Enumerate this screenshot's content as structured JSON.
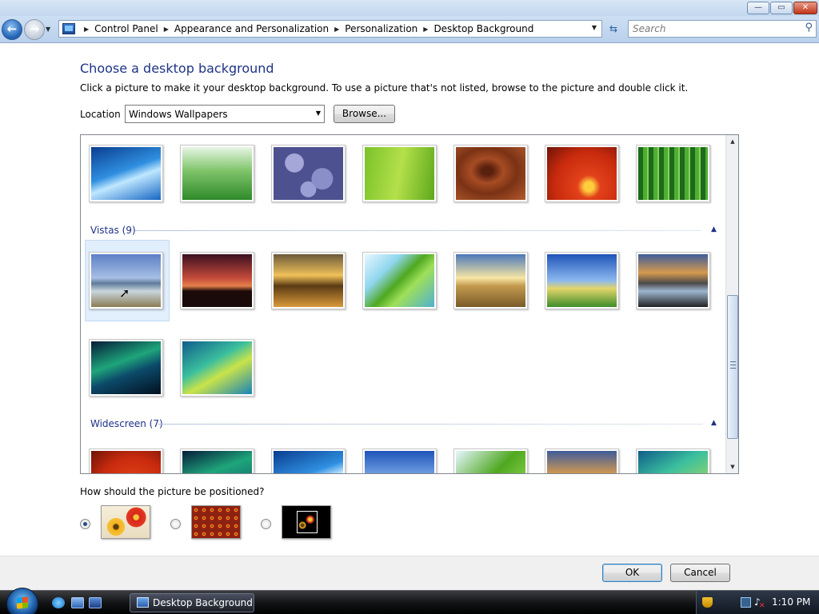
{
  "window": {
    "minimize_glyph": "—",
    "maximize_glyph": "▭",
    "close_glyph": "✕"
  },
  "nav": {
    "back_glyph": "←",
    "forward_glyph": "→",
    "breadcrumbs": [
      "Control Panel",
      "Appearance and Personalization",
      "Personalization",
      "Desktop Background"
    ],
    "search_placeholder": "Search"
  },
  "page": {
    "title": "Choose a desktop background",
    "description": "Click a picture to make it your desktop background. To use a picture that's not listed, browse to the picture and double click it.",
    "location_label": "Location",
    "location_value": "Windows Wallpapers",
    "browse_label": "Browse..."
  },
  "gallery": {
    "groups": [
      {
        "name": "Vistas (9)"
      },
      {
        "name": "Widescreen (7)"
      }
    ],
    "top_row": [
      {
        "subject": "fish"
      },
      {
        "subject": "grass"
      },
      {
        "subject": "stones"
      },
      {
        "subject": "leaf"
      },
      {
        "subject": "wood"
      },
      {
        "subject": "flower"
      },
      {
        "subject": "bamboo"
      }
    ],
    "vistas": [
      {
        "subject": "mountain-lake",
        "selected": true
      },
      {
        "subject": "sunset-silhouette"
      },
      {
        "subject": "rocky-coast"
      },
      {
        "subject": "palm-leaf"
      },
      {
        "subject": "sunrise-field"
      },
      {
        "subject": "green-hills"
      },
      {
        "subject": "rock-reflection"
      },
      {
        "subject": "aurora"
      },
      {
        "subject": "aurora-green"
      }
    ],
    "widescreen": [
      {
        "subject": "flower"
      },
      {
        "subject": "aurora"
      },
      {
        "subject": "fish"
      },
      {
        "subject": "green-hills"
      },
      {
        "subject": "palm-leaf"
      },
      {
        "subject": "rock-reflection"
      },
      {
        "subject": "aurora-green"
      }
    ]
  },
  "positioning": {
    "question": "How should the picture be positioned?",
    "options": [
      {
        "mode": "fit-to-screen",
        "selected": true
      },
      {
        "mode": "tile",
        "selected": false
      },
      {
        "mode": "center",
        "selected": false
      }
    ]
  },
  "buttons": {
    "ok": "OK",
    "cancel": "Cancel"
  },
  "taskbar": {
    "task_label": "Desktop Background",
    "clock": "1:10 PM"
  },
  "colors": {
    "title_blue": "#1e3287",
    "selection_bg": "#e1eefc"
  }
}
